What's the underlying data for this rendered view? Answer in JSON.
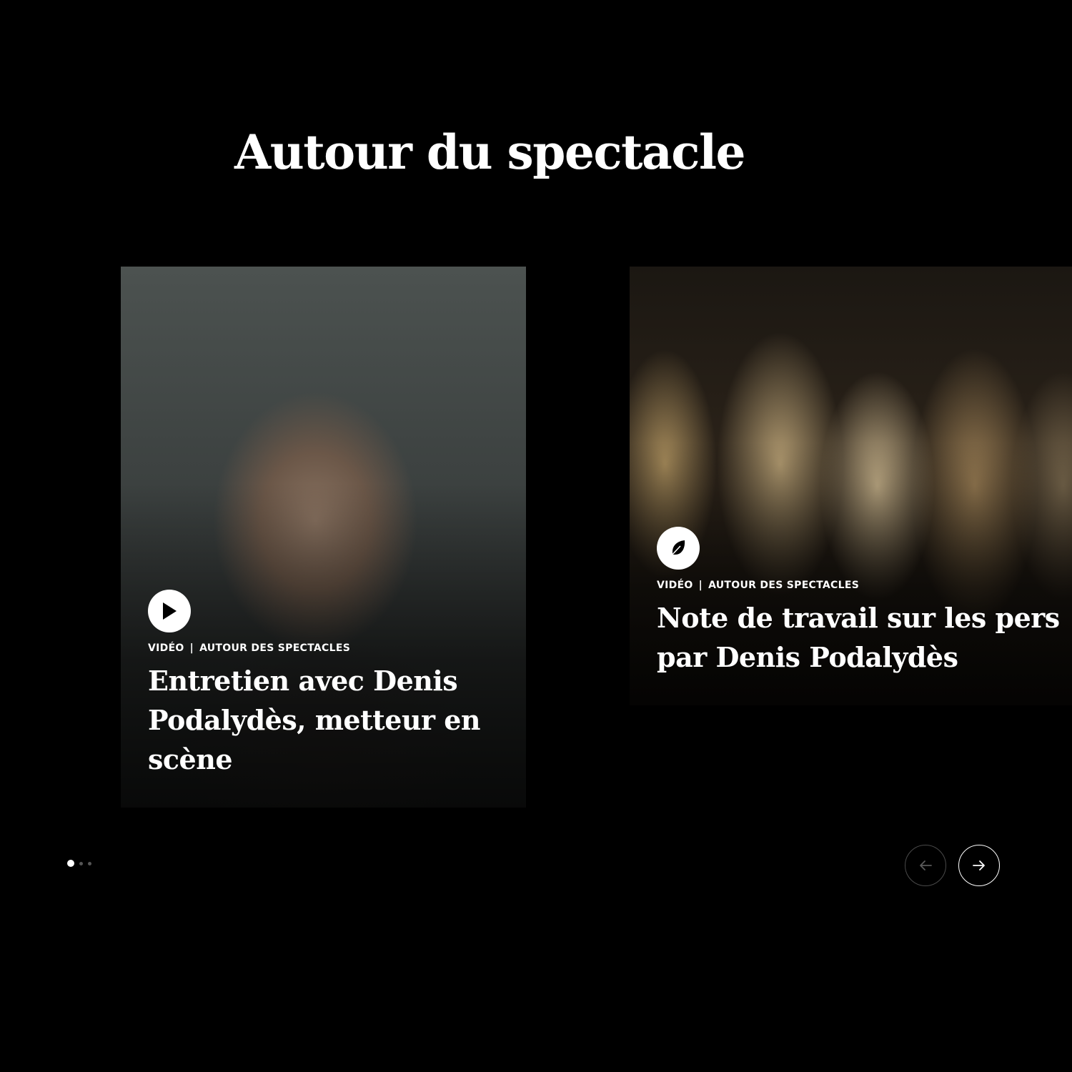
{
  "section": {
    "title": "Autour du spectacle"
  },
  "cards": [
    {
      "icon": "play-icon",
      "type": "VIDÉO",
      "separator": "|",
      "category": "AUTOUR DES SPECTACLES",
      "title": "Entretien avec Denis Podalydès, metteur en scène"
    },
    {
      "icon": "feather-icon",
      "type": "VIDÉO",
      "separator": "|",
      "category": "AUTOUR DES SPECTACLES",
      "title_line1": "Note de travail sur les pers",
      "title_line2": "par Denis Podalydès"
    }
  ],
  "carousel": {
    "dots": 3,
    "active_dot": 1,
    "prev_icon": "arrow-left-icon",
    "next_icon": "arrow-right-icon",
    "prev_enabled": false,
    "next_enabled": true
  },
  "colors": {
    "background": "#000000",
    "text": "#ffffff",
    "disabled_border": "#4a4a4a"
  }
}
